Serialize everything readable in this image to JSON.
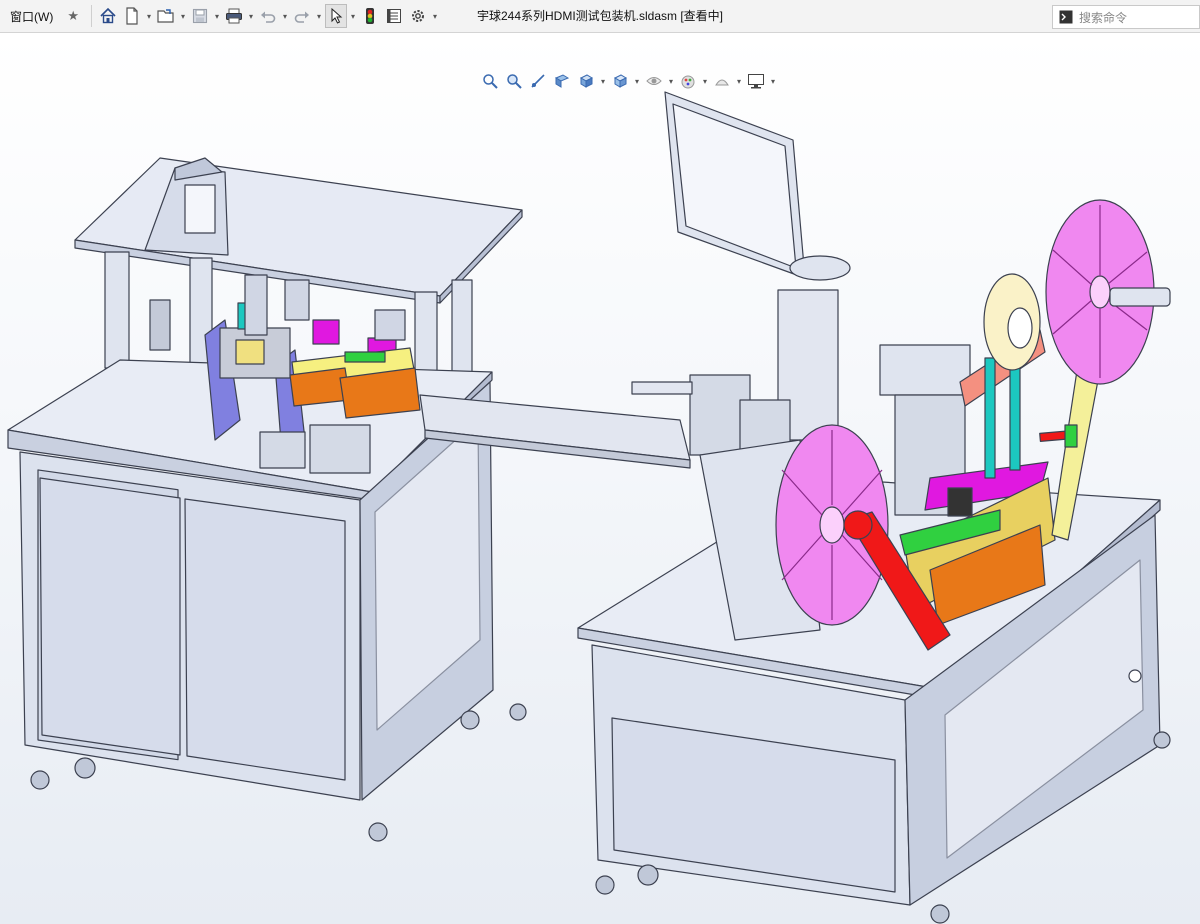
{
  "menubar": {
    "window_menu": "窗口(W)",
    "document_title": "宇球244系列HDMI测试包装机.sldasm [查看中]"
  },
  "search": {
    "placeholder": "搜索命令"
  },
  "toolbar": {
    "icons": [
      "pin-icon",
      "home-icon",
      "new-document-icon",
      "open-folder-icon",
      "save-icon",
      "print-icon",
      "undo-icon",
      "redo-icon",
      "select-arrow-icon",
      "rebuild-traffic-light-icon",
      "file-properties-icon",
      "options-gear-icon"
    ]
  },
  "headsup_toolbar": {
    "icons": [
      "zoom-to-fit-icon",
      "zoom-to-area-icon",
      "previous-view-icon",
      "section-view-icon",
      "view-orientation-icon",
      "display-style-icon",
      "hide-show-items-icon",
      "edit-appearance-icon",
      "apply-scene-icon",
      "view-settings-icon"
    ]
  },
  "model": {
    "name": "宇球244系列HDMI测试包装机",
    "colors": {
      "frame": "#dde3f0",
      "frame_edge": "#3c4150",
      "reel_pink": "#f088f0",
      "reel_cream": "#faf2c8",
      "yellow_arm": "#f4f09a",
      "red_arm": "#f01818",
      "orange_block": "#e87818",
      "teal_plate": "#1cc8c0",
      "magenta_plate": "#e018e0",
      "green_rail": "#30d040",
      "blue_part": "#8080e0",
      "salmon_plate": "#f49080",
      "gold_frame": "#e8d060"
    }
  }
}
